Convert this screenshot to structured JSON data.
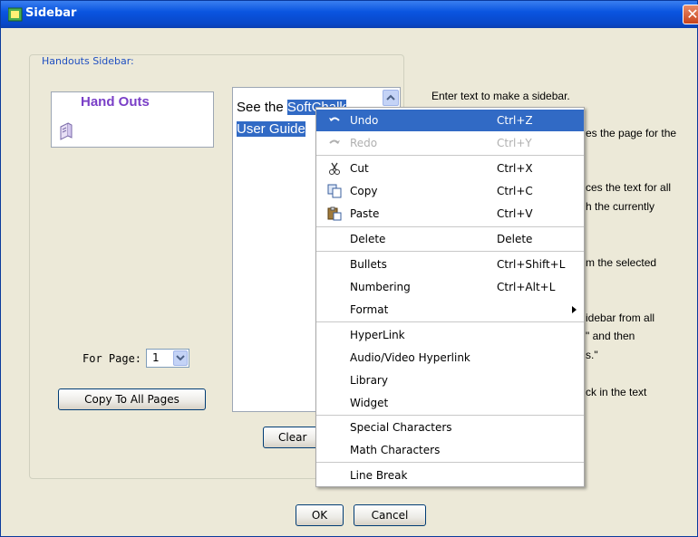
{
  "window": {
    "title": "Sidebar",
    "close_symbol": "✕"
  },
  "group": {
    "legend": "Handouts Sidebar:"
  },
  "preview": {
    "title": "Hand Outs"
  },
  "editor": {
    "line1_plain": "See the ",
    "line1_selected": "SoftChalk",
    "line2_selected": "User Guide"
  },
  "page_selector": {
    "label": "For Page:",
    "value": "1"
  },
  "buttons": {
    "copy_all": "Copy To All Pages",
    "clear": "Clear",
    "ok": "OK",
    "cancel": "Cancel"
  },
  "help_text": {
    "line1": "Enter text to make a sidebar.",
    "line2": "es the page for the",
    "line3": "ces the text for all",
    "line4": "h the currently",
    "line5": "m the selected",
    "line6": "idebar from all",
    "line7": "\" and then",
    "line8": "s.\"",
    "line9": "ck in the text"
  },
  "context_menu": {
    "undo": {
      "label": "Undo",
      "shortcut": "Ctrl+Z",
      "icon": "undo-icon"
    },
    "redo": {
      "label": "Redo",
      "shortcut": "Ctrl+Y",
      "icon": "redo-icon"
    },
    "cut": {
      "label": "Cut",
      "shortcut": "Ctrl+X",
      "icon": "scissors-icon"
    },
    "copy": {
      "label": "Copy",
      "shortcut": "Ctrl+C",
      "icon": "copy-icon"
    },
    "paste": {
      "label": "Paste",
      "shortcut": "Ctrl+V",
      "icon": "paste-icon"
    },
    "delete": {
      "label": "Delete",
      "shortcut": "Delete"
    },
    "bullets": {
      "label": "Bullets",
      "shortcut": "Ctrl+Shift+L"
    },
    "numbering": {
      "label": "Numbering",
      "shortcut": "Ctrl+Alt+L"
    },
    "format": {
      "label": "Format"
    },
    "hyperlink": {
      "label": "HyperLink"
    },
    "av_hyperlink": {
      "label": "Audio/Video Hyperlink"
    },
    "library": {
      "label": "Library"
    },
    "widget": {
      "label": "Widget"
    },
    "special_chars": {
      "label": "Special Characters"
    },
    "math_chars": {
      "label": "Math Characters"
    },
    "line_break": {
      "label": "Line Break"
    }
  },
  "colors": {
    "title_bar": "#0a55e0",
    "selection": "#316ac5",
    "preview_title": "#7a3fc7",
    "legend": "#1f4fc1"
  }
}
